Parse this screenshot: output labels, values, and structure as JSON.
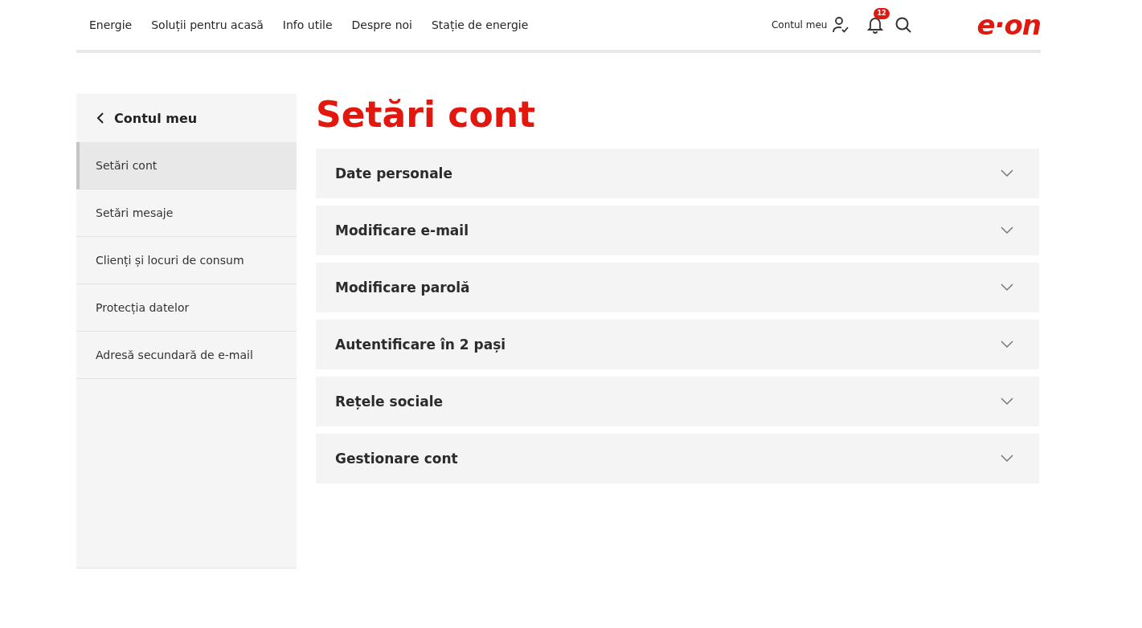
{
  "nav": {
    "items": [
      {
        "label": "Energie"
      },
      {
        "label": "Soluții pentru acasă"
      },
      {
        "label": "Info utile"
      },
      {
        "label": "Despre noi"
      },
      {
        "label": "Stație de energie"
      }
    ],
    "account_link": "Contul meu",
    "notifications_badge": "12",
    "logo": "e·on"
  },
  "sidebar": {
    "back_label": "Contul meu",
    "items": [
      {
        "label": "Setări cont",
        "selected": true
      },
      {
        "label": "Setări mesaje",
        "selected": false
      },
      {
        "label": "Clienți și locuri de consum",
        "selected": false
      },
      {
        "label": "Protecția datelor",
        "selected": false
      },
      {
        "label": "Adresă secundară de e-mail",
        "selected": false
      }
    ]
  },
  "page_title": "Setări cont",
  "sections": [
    {
      "title": "Date personale",
      "expanded": false
    },
    {
      "title": "Modificare e-mail",
      "expanded": false
    },
    {
      "title": "Modificare parolă",
      "expanded": false
    },
    {
      "title": "Autentificare în 2 pași",
      "expanded": false
    },
    {
      "title": "Rețele sociale",
      "expanded": false
    },
    {
      "title": "Gestionare cont",
      "expanded": false
    }
  ]
}
